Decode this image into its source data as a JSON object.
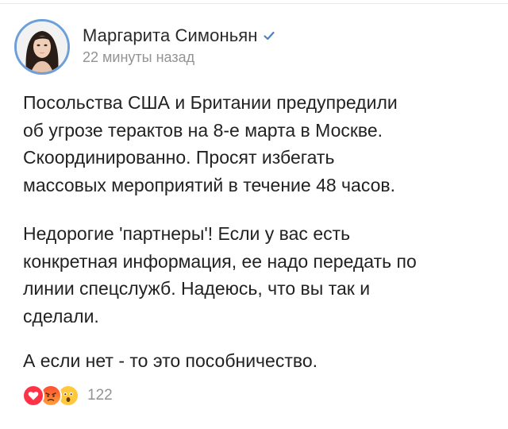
{
  "post": {
    "author": {
      "name": "Маргарита Симоньян",
      "verified": true,
      "avatar": "avatar-photo"
    },
    "time": "22 минуты назад",
    "paragraphs": [
      "Посольства США и Британии  предупредили\nоб угрозе терактов на 8-е марта в Москве.\nСкоординированно. Просят избегать\nмассовых мероприятий в течение 48 часов.",
      "Недорогие 'партнеры'! Если у вас есть\nконкретная информация, ее надо передать по\nлинии спецслужб. Надеюсь, что вы так и\nсделали.",
      "А если нет - то это пособничество."
    ],
    "reactions": {
      "icons": [
        "heart-icon",
        "angry-face-icon",
        "shocked-face-icon"
      ],
      "count": "122"
    }
  },
  "colors": {
    "verified": "#5181b8",
    "avatar_ring": "#6d9fd8",
    "heart": "#ff3347",
    "angry": "#ff7a2f",
    "shocked": "#ffc83d",
    "muted_text": "#939393"
  }
}
